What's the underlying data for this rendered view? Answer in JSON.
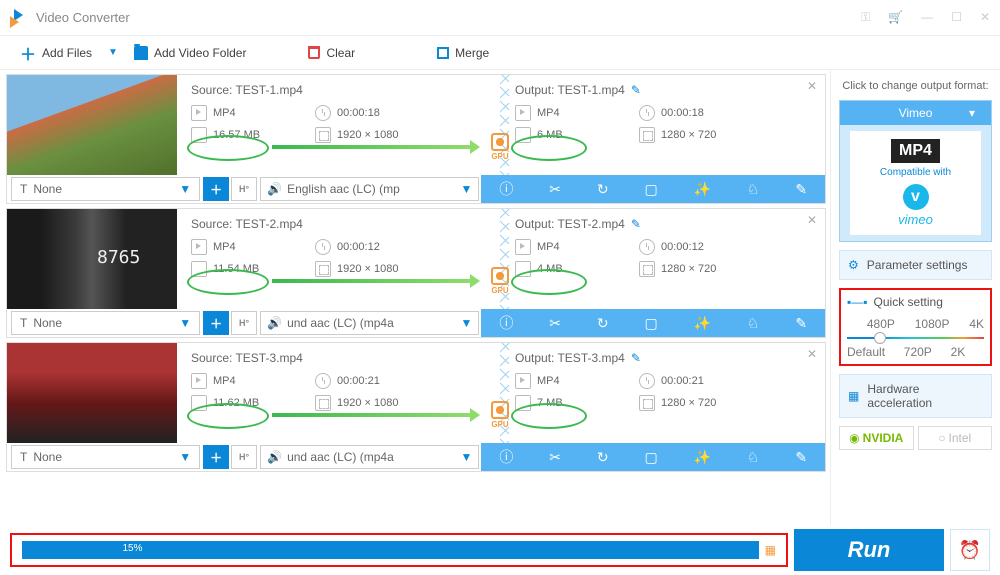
{
  "app": {
    "title": "Video Converter"
  },
  "toolbar": {
    "add_files": "Add Files",
    "add_folder": "Add Video Folder",
    "clear": "Clear",
    "merge": "Merge"
  },
  "rows": [
    {
      "source_label": "Source: TEST-1.mp4",
      "output_label": "Output: TEST-1.mp4",
      "src": {
        "format": "MP4",
        "duration": "00:00:18",
        "size": "16.57 MB",
        "dims": "1920 × 1080"
      },
      "out": {
        "format": "MP4",
        "duration": "00:00:18",
        "size": "6 MB",
        "dims": "1280 × 720"
      },
      "sub": "None",
      "audio": "English aac (LC) (mp",
      "gpu": "GPU"
    },
    {
      "source_label": "Source: TEST-2.mp4",
      "output_label": "Output: TEST-2.mp4",
      "src": {
        "format": "MP4",
        "duration": "00:00:12",
        "size": "11.54 MB",
        "dims": "1920 × 1080"
      },
      "out": {
        "format": "MP4",
        "duration": "00:00:12",
        "size": "4 MB",
        "dims": "1280 × 720"
      },
      "sub": "None",
      "audio": "und aac (LC) (mp4a",
      "gpu": "GPU"
    },
    {
      "source_label": "Source: TEST-3.mp4",
      "output_label": "Output: TEST-3.mp4",
      "src": {
        "format": "MP4",
        "duration": "00:00:21",
        "size": "11.62 MB",
        "dims": "1920 × 1080"
      },
      "out": {
        "format": "MP4",
        "duration": "00:00:21",
        "size": "7 MB",
        "dims": "1280 × 720"
      },
      "sub": "None",
      "audio": "und aac (LC) (mp4a",
      "gpu": "GPU"
    }
  ],
  "sidebar": {
    "title": "Click to change output format:",
    "preset_name": "Vimeo",
    "mp4": "MP4",
    "compat": "Compatible with",
    "vimeo": "vimeo",
    "param": "Parameter settings",
    "quick": "Quick setting",
    "res": {
      "p480": "480P",
      "p720": "720P",
      "p1080": "1080P",
      "p2k": "2K",
      "p4k": "4K",
      "def": "Default"
    },
    "hw": "Hardware acceleration",
    "nvidia": "NVIDIA",
    "intel": "Intel"
  },
  "bottom": {
    "progress": "15%",
    "run": "Run"
  }
}
